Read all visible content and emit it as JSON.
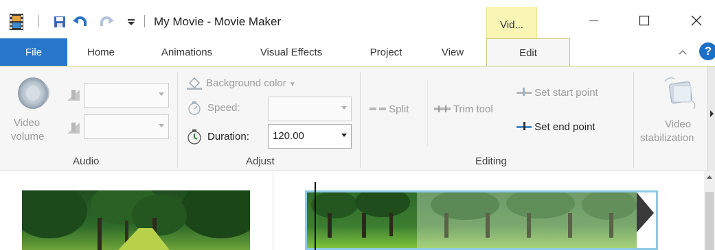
{
  "window": {
    "title": "My Movie - Movie Maker",
    "contextual_tab_group": "Vid..."
  },
  "quick_access": {
    "icons": [
      "film-app-icon",
      "save-icon",
      "undo-icon",
      "redo-icon",
      "customize-dropdown-icon"
    ]
  },
  "window_controls": {
    "icons": [
      "minimize-icon",
      "maximize-icon",
      "close-icon"
    ]
  },
  "tabs": [
    {
      "label": "File",
      "active": false
    },
    {
      "label": "Home",
      "active": false
    },
    {
      "label": "Animations",
      "active": false
    },
    {
      "label": "Visual Effects",
      "active": false
    },
    {
      "label": "Project",
      "active": false
    },
    {
      "label": "View",
      "active": false
    },
    {
      "label": "Edit",
      "active": true
    }
  ],
  "ribbon": {
    "audio": {
      "group_label": "Audio",
      "video_volume_label_1": "Video",
      "video_volume_label_2": "volume"
    },
    "adjust": {
      "group_label": "Adjust",
      "background_color": "Background color",
      "speed": "Speed:",
      "duration": "Duration:",
      "duration_value": "120.00"
    },
    "editing": {
      "group_label": "Editing",
      "split": "Split",
      "trim_tool": "Trim tool",
      "set_start_point": "Set start point",
      "set_end_point": "Set end point"
    },
    "stabilization": {
      "label_1": "Video",
      "label_2": "stabilization"
    }
  },
  "colors": {
    "file_tab": "#2776c9",
    "contextual_tab": "#f9f5b4",
    "clip_border": "#8dcbe6",
    "help": "#1c6fc6"
  }
}
